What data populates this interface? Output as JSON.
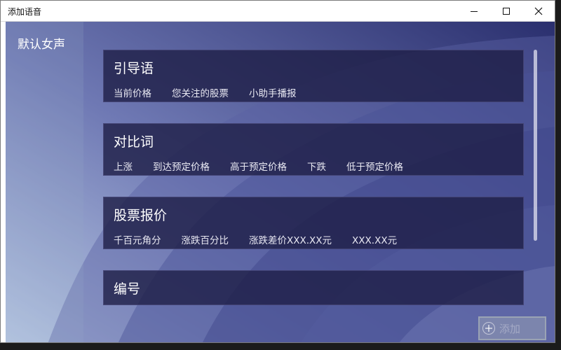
{
  "window": {
    "title": "添加语音"
  },
  "sidebar": {
    "items": [
      {
        "label": "默认女声"
      }
    ]
  },
  "sections": [
    {
      "title": "引导语",
      "chips": [
        "当前价格",
        "您关注的股票",
        "小助手播报"
      ]
    },
    {
      "title": "对比词",
      "chips": [
        "上涨",
        "到达预定价格",
        "高于预定价格",
        "下跌",
        "低于预定价格"
      ]
    },
    {
      "title": "股票报价",
      "chips": [
        "千百元角分",
        "涨跌百分比",
        "涨跌差价XXX.XX元",
        "XXX.XX元"
      ]
    },
    {
      "title": "编号",
      "chips": []
    }
  ],
  "actions": {
    "add_label": "添加"
  },
  "icons": {
    "minimize": "minimize-icon",
    "maximize": "maximize-icon",
    "close": "close-icon",
    "add": "plus-circle-icon"
  }
}
